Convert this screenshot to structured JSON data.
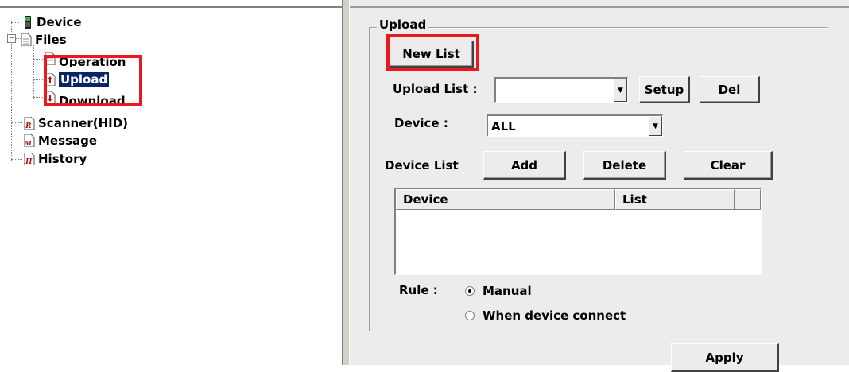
{
  "tree": {
    "items": [
      {
        "label": "Device",
        "icon": "device-icon"
      },
      {
        "label": "Files",
        "icon": "file-icon",
        "expander": "−"
      },
      {
        "label": "Operation",
        "icon": "file-icon"
      },
      {
        "label": "Upload",
        "icon": "upload-file-icon",
        "selected": true
      },
      {
        "label": "Download",
        "icon": "download-file-icon"
      },
      {
        "label": "Scanner(HID)",
        "icon": "scanner-file-icon"
      },
      {
        "label": "Message",
        "icon": "message-file-icon"
      },
      {
        "label": "History",
        "icon": "history-file-icon"
      }
    ]
  },
  "panel": {
    "group_title": "Upload",
    "new_list_button": "New List",
    "upload_list_label": "Upload List :",
    "upload_list_value": "",
    "setup_button": "Setup",
    "del_button": "Del",
    "device_label": "Device :",
    "device_value": "ALL",
    "device_list_label": "Device List",
    "add_button": "Add",
    "delete_button": "Delete",
    "clear_button": "Clear",
    "columns": [
      "Device",
      "List"
    ],
    "rule_label": "Rule :",
    "rule_options": [
      "Manual",
      "When device connect"
    ],
    "rule_selected": "Manual",
    "apply_button": "Apply"
  },
  "colors": {
    "highlight": "#e8191f",
    "selection": "#0a246a"
  }
}
